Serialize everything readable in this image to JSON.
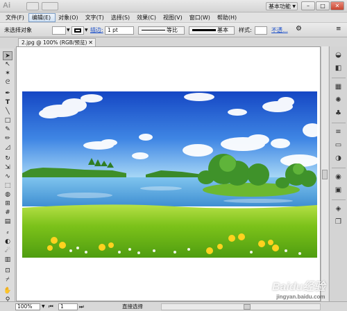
{
  "appbar": {
    "logo": "Ai",
    "workspace_label": "基本功能",
    "win_min": "–",
    "win_max": "□",
    "win_close": "✕"
  },
  "menu": [
    {
      "label": "文件(F)"
    },
    {
      "label": "编辑(E)"
    },
    {
      "label": "对象(O)"
    },
    {
      "label": "文字(T)"
    },
    {
      "label": "选择(S)"
    },
    {
      "label": "效果(C)"
    },
    {
      "label": "视图(V)"
    },
    {
      "label": "窗口(W)"
    },
    {
      "label": "帮助(H)"
    }
  ],
  "controlbar": {
    "selection": "未选择对象",
    "stroke_label": "描边:",
    "stroke_weight": "1 pt",
    "stroke_profile": "等比",
    "brush": "基本",
    "style_label": "样式:",
    "opacity_link": "不透..."
  },
  "document": {
    "tab_title": "2.jpg @ 100% (RGB/预览)",
    "close": "✕"
  },
  "statusbar": {
    "zoom": "100%",
    "artboard": "1",
    "tool_name": "直接选择"
  },
  "watermark": {
    "text": "Baidu经验",
    "sub": "jingyan.baidu.com"
  },
  "colors": {
    "sky_top": "#1a52c9",
    "sky_bottom": "#8ec8f2",
    "water": "#5aa9e0",
    "grass": "#7cc21a",
    "flowers": "#ffd21f"
  },
  "tools_icons": [
    "selection-tool",
    "direct-selection-tool",
    "magic-wand-tool",
    "lasso-tool",
    "pen-tool",
    "type-tool",
    "line-tool",
    "rectangle-tool",
    "paintbrush-tool",
    "pencil-tool",
    "eraser-tool",
    "rotate-tool",
    "scale-tool",
    "warp-tool",
    "free-transform-tool",
    "shape-builder-tool",
    "perspective-tool",
    "mesh-tool",
    "gradient-tool",
    "eyedropper-tool",
    "blend-tool",
    "symbol-sprayer-tool",
    "graph-tool",
    "artboard-tool",
    "slice-tool",
    "hand-tool",
    "zoom-tool"
  ]
}
